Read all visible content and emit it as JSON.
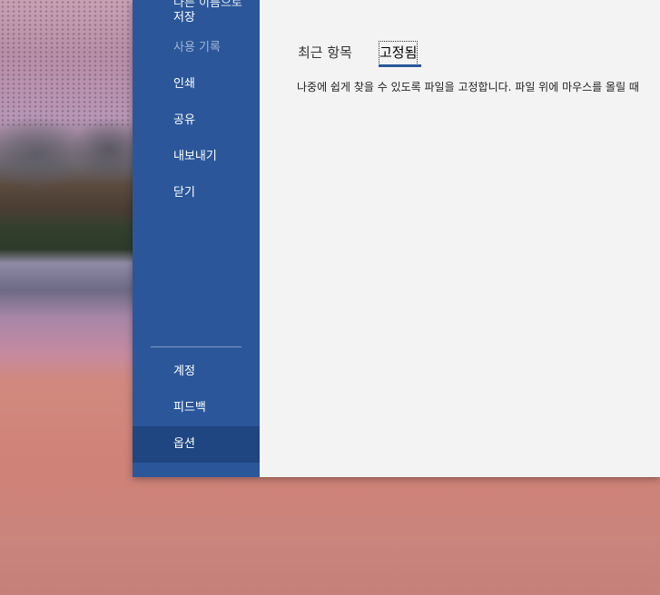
{
  "sidebar": {
    "items": [
      {
        "label": "저장"
      },
      {
        "label": "사용 기록",
        "disabled": true
      },
      {
        "label": "인쇄"
      },
      {
        "label": "공유"
      },
      {
        "label": "내보내기"
      },
      {
        "label": "닫기"
      }
    ],
    "bottom_items": [
      {
        "label": "계정"
      },
      {
        "label": "피드백"
      },
      {
        "label": "옵션",
        "selected": true
      }
    ],
    "partial_item_top": "다른 이름으로"
  },
  "content": {
    "tabs": [
      {
        "label": "최근 항목"
      },
      {
        "label": "고정됨",
        "active": true
      }
    ],
    "hint": "나중에 쉽게 찾을 수 있도록 파일을 고정합니다. 파일 위에 마우스를 올릴 때"
  },
  "colors": {
    "sidebar_bg": "#2b579a",
    "sidebar_selected": "#1f4681",
    "content_bg": "#f3f3f3",
    "accent": "#2b579a"
  }
}
